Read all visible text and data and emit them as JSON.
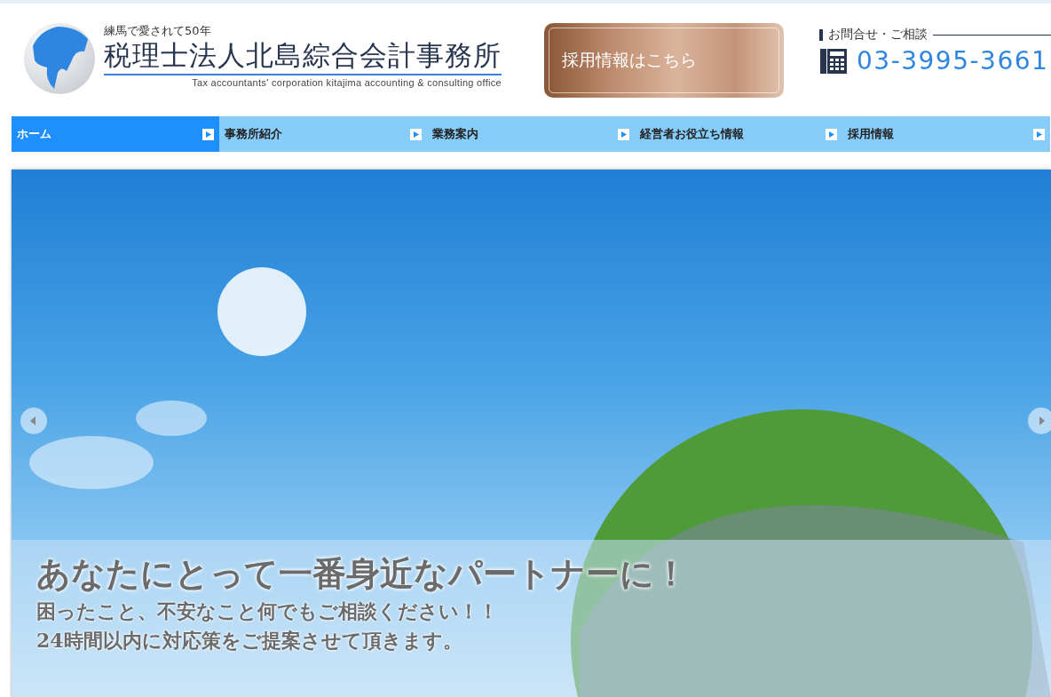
{
  "header": {
    "tagline": "練馬で愛されて50年",
    "company_name": "税理士法人北島綜合会計事務所",
    "company_name_en": "Tax accountants' corporation kitajima accounting & consulting office"
  },
  "recruit_banner": {
    "label": "採用情報はこちら"
  },
  "contact": {
    "heading": "お問合せ・ご相談",
    "phone": "03-3995-3661"
  },
  "nav": [
    {
      "label": "ホーム",
      "selected": true
    },
    {
      "label": "事務所紹介",
      "selected": false
    },
    {
      "label": "業務案内",
      "selected": false
    },
    {
      "label": "経営者お役立ち情報",
      "selected": false
    },
    {
      "label": "採用情報",
      "selected": false
    }
  ],
  "hero": {
    "headline": "あなたにとって一番身近なパートナーに！",
    "lines": [
      "困ったこと、不安なこと何でもご相談ください！！",
      "24時間以内に対応策をご提案させて頂きます。"
    ]
  }
}
